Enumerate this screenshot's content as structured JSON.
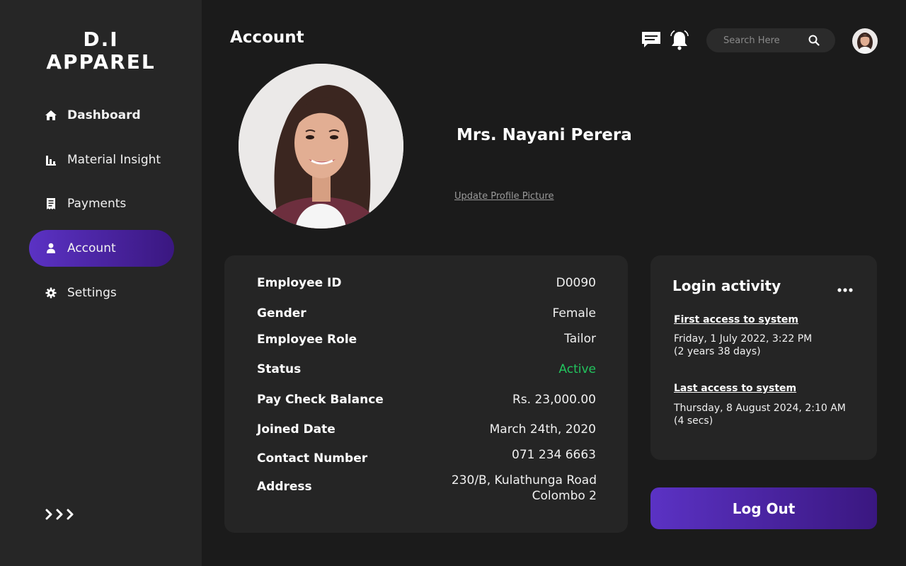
{
  "brand": {
    "line1": "D.I",
    "line2": "APPAREL"
  },
  "sidebar": {
    "items": [
      {
        "label": "Dashboard",
        "icon": "home-icon"
      },
      {
        "label": "Material Insight",
        "icon": "bar-chart-icon"
      },
      {
        "label": "Payments",
        "icon": "receipt-icon"
      },
      {
        "label": "Account",
        "icon": "user-icon",
        "active": true
      },
      {
        "label": "Settings",
        "icon": "gear-icon"
      }
    ],
    "expand_icon": "triple-chevron-right-icon"
  },
  "header": {
    "title": "Account",
    "search_placeholder": "Search Here"
  },
  "profile": {
    "name": "Mrs. Nayani Perera",
    "update_link": "Update Profile Picture"
  },
  "details": {
    "rows": [
      {
        "label": "Employee ID",
        "value": "D0090"
      },
      {
        "label": "Gender",
        "value": "Female"
      },
      {
        "label": "Employee Role",
        "value": "Tailor"
      },
      {
        "label": "Status",
        "value": "Active"
      },
      {
        "label": "Pay Check Balance",
        "value": "Rs. 23,000.00"
      },
      {
        "label": "Joined Date",
        "value": "March 24th, 2020"
      },
      {
        "label": "Contact Number",
        "value": "071 234 6663"
      },
      {
        "label": "Address",
        "value_line1": "230/B, Kulathunga Road",
        "value_line2": "Colombo 2"
      }
    ]
  },
  "login_activity": {
    "title": "Login activity",
    "first": {
      "heading": "First access to system",
      "date": "Friday, 1 July 2022, 3:22 PM",
      "ago": "(2 years 38 days)"
    },
    "last": {
      "heading": "Last access to system",
      "date": "Thursday, 8 August 2024, 2:10 AM",
      "ago": "(4 secs)"
    }
  },
  "logout_label": "Log Out",
  "colors": {
    "accent_start": "#5b32c4",
    "accent_end": "#3a1780",
    "status_active": "#22c55e",
    "background": "#1b1b1b",
    "sidebar": "#262626",
    "card": "#252525"
  }
}
